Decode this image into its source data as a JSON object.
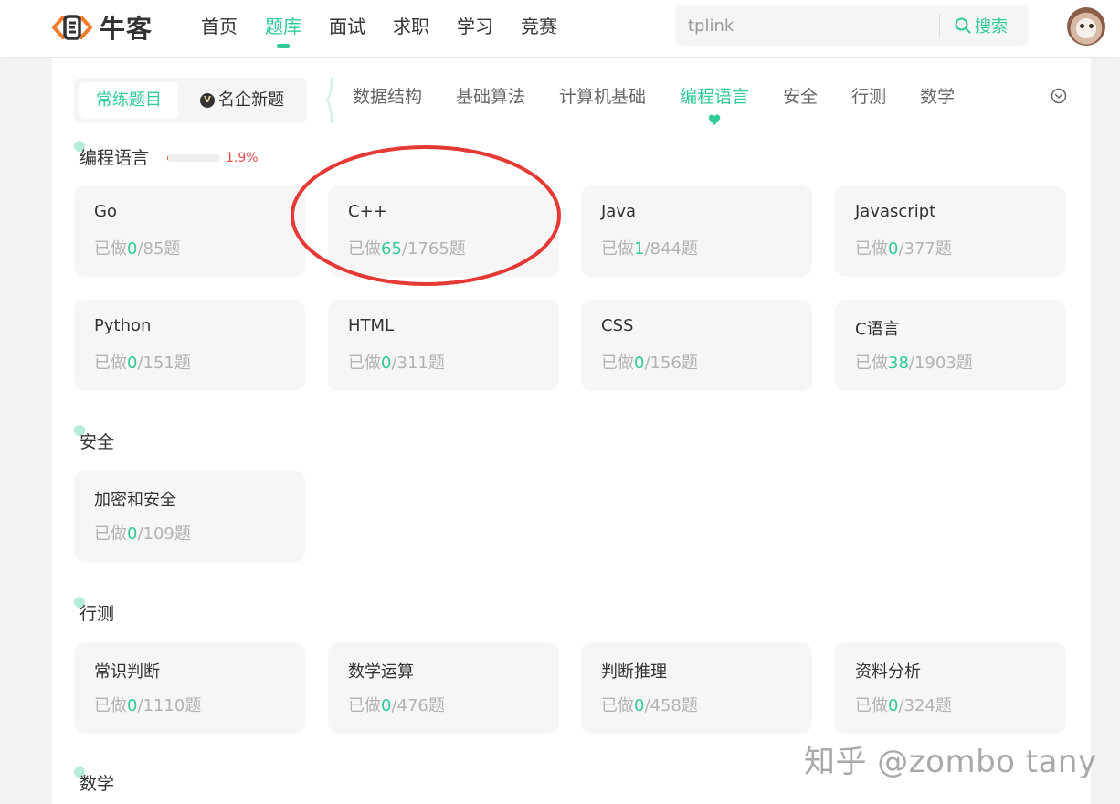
{
  "header": {
    "logo_text": "牛客",
    "nav": [
      "首页",
      "题库",
      "面试",
      "求职",
      "学习",
      "竞赛"
    ],
    "active_nav": "题库",
    "search_value": "tplink",
    "search_button": "搜索"
  },
  "filter": {
    "segments": [
      "常练题目",
      "名企新题"
    ],
    "active_segment": "常练题目",
    "vip_badge": "V",
    "tabs": [
      "数据结构",
      "基础算法",
      "计算机基础",
      "编程语言",
      "安全",
      "行测",
      "数学"
    ],
    "active_tab": "编程语言"
  },
  "sections": [
    {
      "title": "编程语言",
      "progress_pct": 1.9,
      "progress_text": "1.9%",
      "cards": [
        {
          "name": "Go",
          "prefix": "已做",
          "done": "0",
          "rest": "/85题"
        },
        {
          "name": "C++",
          "prefix": "已做",
          "done": "65",
          "rest": "/1765题"
        },
        {
          "name": "Java",
          "prefix": "已做",
          "done": "1",
          "rest": "/844题"
        },
        {
          "name": "Javascript",
          "prefix": "已做",
          "done": "0",
          "rest": "/377题"
        },
        {
          "name": "Python",
          "prefix": "已做",
          "done": "0",
          "rest": "/151题"
        },
        {
          "name": "HTML",
          "prefix": "已做",
          "done": "0",
          "rest": "/311题"
        },
        {
          "name": "CSS",
          "prefix": "已做",
          "done": "0",
          "rest": "/156题"
        },
        {
          "name": "C语言",
          "prefix": "已做",
          "done": "38",
          "rest": "/1903题"
        }
      ]
    },
    {
      "title": "安全",
      "cards": [
        {
          "name": "加密和安全",
          "prefix": "已做",
          "done": "0",
          "rest": "/109题"
        }
      ]
    },
    {
      "title": "行测",
      "cards": [
        {
          "name": "常识判断",
          "prefix": "已做",
          "done": "0",
          "rest": "/1110题"
        },
        {
          "name": "数学运算",
          "prefix": "已做",
          "done": "0",
          "rest": "/476题"
        },
        {
          "name": "判断推理",
          "prefix": "已做",
          "done": "0",
          "rest": "/458题"
        },
        {
          "name": "资料分析",
          "prefix": "已做",
          "done": "0",
          "rest": "/324题"
        }
      ]
    },
    {
      "title": "数学",
      "cards": []
    }
  ],
  "watermark": "知乎 @zombo tany",
  "colors": {
    "accent": "#32ca99",
    "annotation": "#e53935",
    "progress": "#e64a4a"
  }
}
